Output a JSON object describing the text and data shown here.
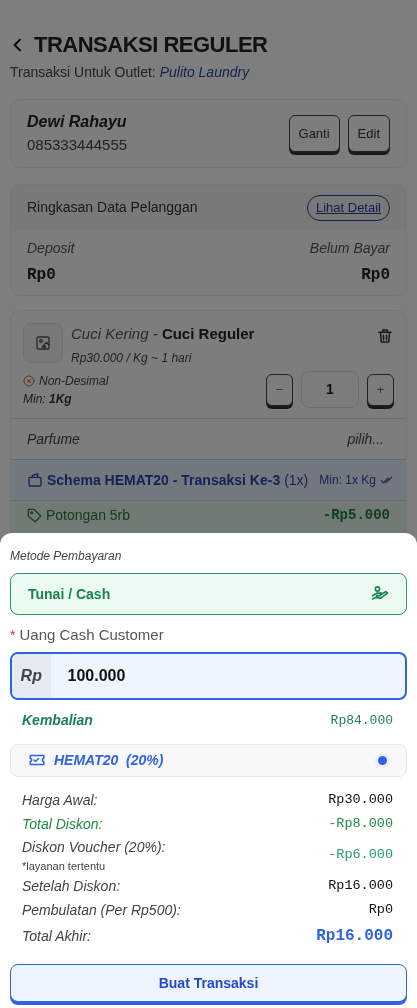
{
  "header": {
    "title": "TRANSAKSI REGULER",
    "outlet_label": "Transaksi Untuk Outlet:",
    "outlet_name": "Pulito Laundry"
  },
  "customer": {
    "name": "Dewi Rahayu",
    "phone": "085333444555",
    "buttons": [
      "Ganti",
      "Edit"
    ]
  },
  "summary": {
    "title": "Ringkasan Data Pelanggan",
    "link": "Lihat Detail",
    "stats": [
      {
        "label": "Deposit",
        "value": "Rp0"
      },
      {
        "label": "Belum Bayar",
        "value": "Rp0"
      }
    ]
  },
  "item": {
    "category": "Cuci Kering",
    "separator": "-",
    "name": "Cuci Reguler",
    "price": "Rp30.000 / Kg ~ 1 hari",
    "decimal_note": "Non-Desimal",
    "minimum": "Min: **1Kg**",
    "minus": "−",
    "quantity": "1",
    "plus": "+",
    "parfume_label": "Parfume",
    "parfume_placeholder": "pilih...",
    "scheme": {
      "title": "Schema HEMAT20 - Transaksi Ke-3",
      "count": "(1x)",
      "minimum": "Min: 1x Kg"
    },
    "discount": {
      "label": "Potongan 5rb",
      "amount": "-Rp5.000"
    }
  },
  "payment": {
    "method_label": "Metode Pembayaran",
    "method": "Tunai / Cash",
    "required_mark": "*",
    "cash_label": "Uang Cash Customer",
    "currency": "Rp",
    "cash_value": "100.000",
    "change_label": "Kembalian",
    "change_value": "Rp84.000",
    "voucher": {
      "code": "HEMAT20",
      "percent": "(20%)",
      "selected": true
    },
    "totals": [
      {
        "kind": "plain",
        "label": "Harga Awal:",
        "value": "Rp30.000"
      },
      {
        "kind": "discount",
        "label": "Total Diskon:",
        "value": "-Rp8.000"
      },
      {
        "kind": "voucher",
        "label": "Diskon Voucher (20%):",
        "note": "*layanan tertentu",
        "value": "-Rp6.000"
      },
      {
        "kind": "plain",
        "label": "Setelah Diskon:",
        "value": "Rp16.000"
      },
      {
        "kind": "plain",
        "label": "Pembulatan (Per Rp500):",
        "value": "Rp0"
      },
      {
        "kind": "total",
        "label": "Total Akhir:",
        "value": "Rp16.000"
      }
    ],
    "submit": "Buat Transaksi"
  }
}
